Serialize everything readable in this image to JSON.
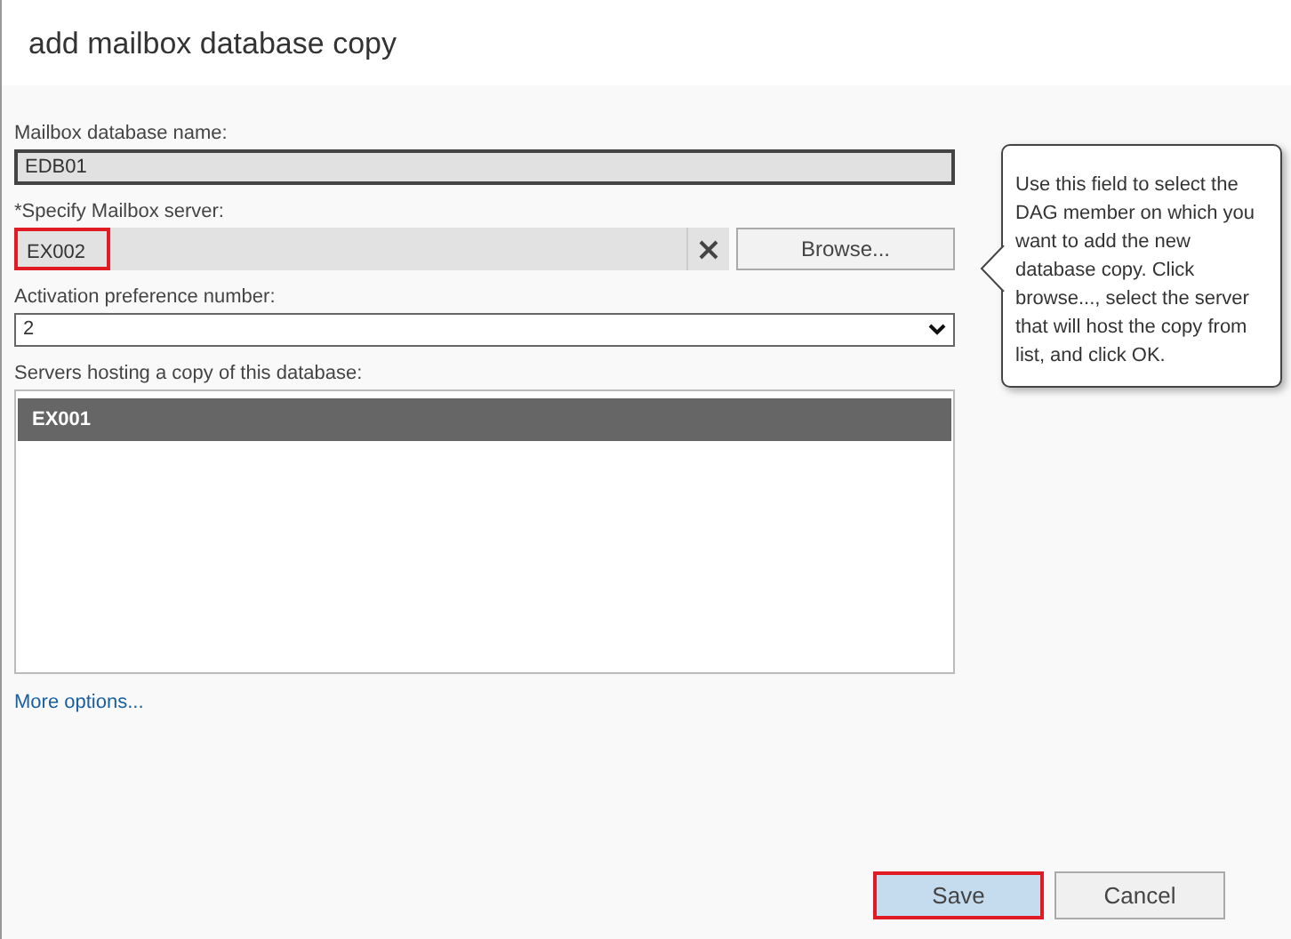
{
  "dialog": {
    "title": "add mailbox database copy"
  },
  "database_name": {
    "label": "Mailbox database name:",
    "value": "EDB01"
  },
  "mailbox_server": {
    "label": "*Specify Mailbox server:",
    "value": "EX002",
    "highlighted": true,
    "browse_button": "Browse..."
  },
  "activation_preference": {
    "label": "Activation preference number:",
    "value": "2"
  },
  "servers_hosting": {
    "label": "Servers hosting a copy of this database:",
    "items": [
      {
        "text": "EX001",
        "selected": true
      }
    ]
  },
  "more_options_link": "More options...",
  "tooltip": "Use this field to select the DAG member on which you want to add the new database copy. Click browse..., select the server that will host the copy from list, and click OK.",
  "buttons": [
    {
      "label": "Save",
      "kind": "primary",
      "highlighted": true
    },
    {
      "label": "Cancel",
      "kind": "secondary",
      "highlighted": false
    }
  ]
}
